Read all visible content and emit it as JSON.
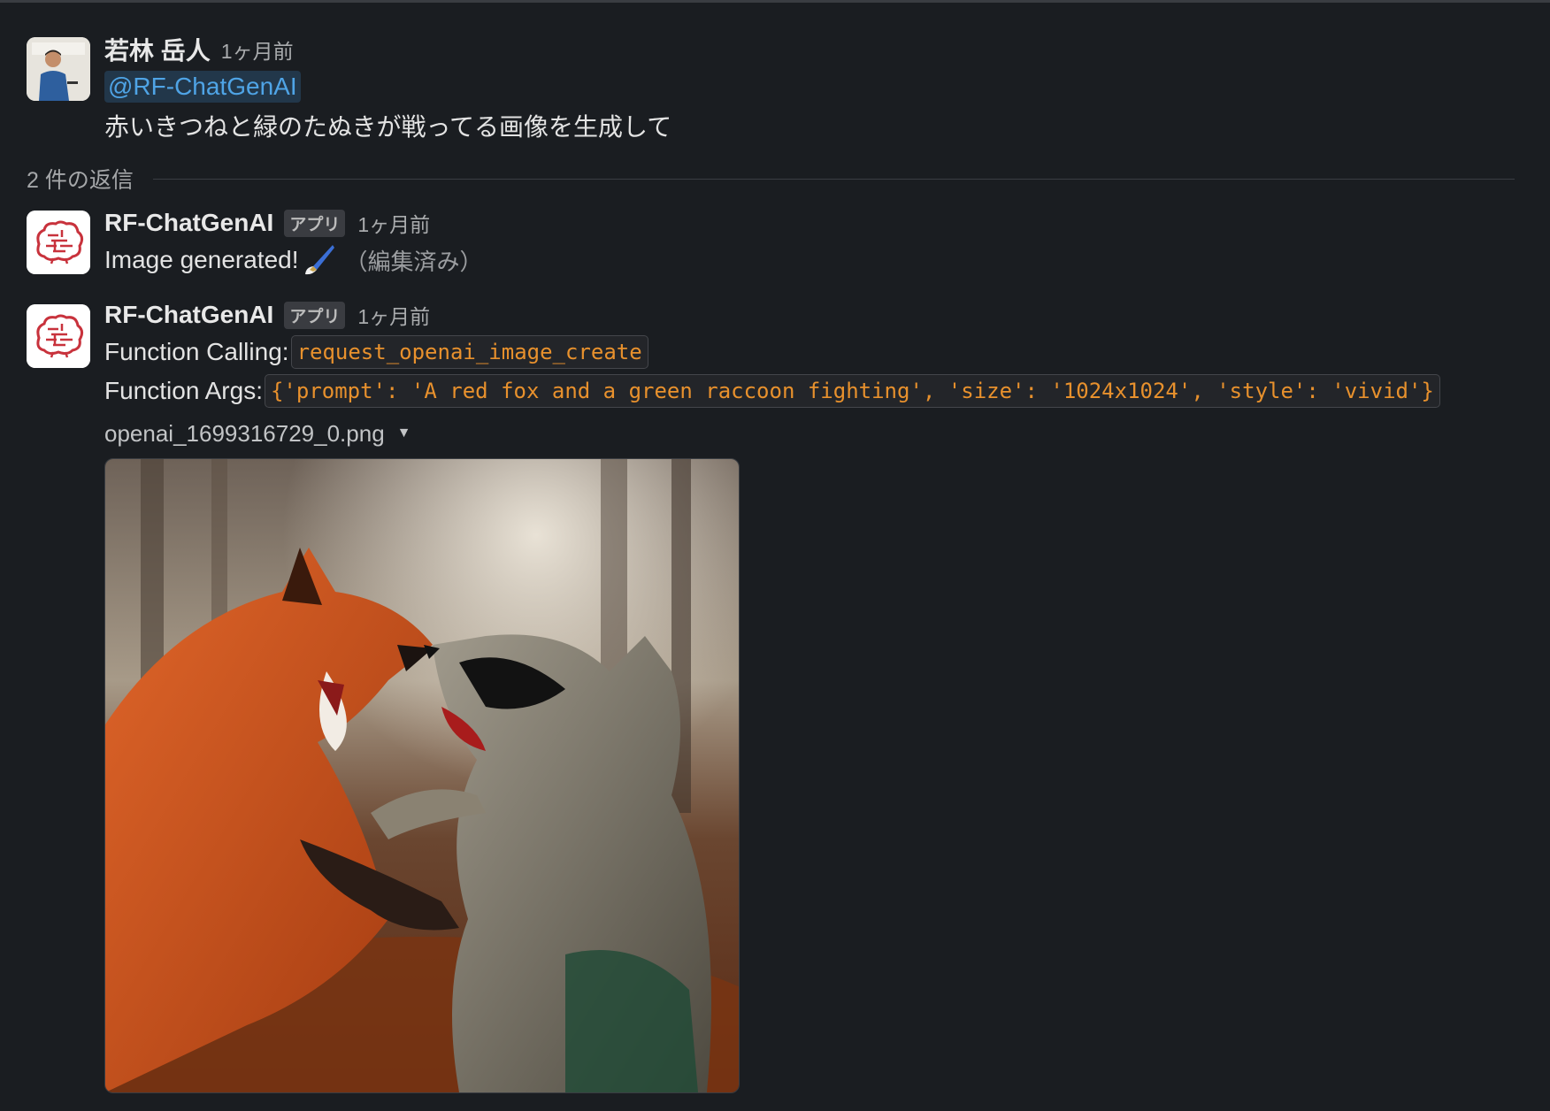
{
  "original_message": {
    "author": "若林 岳人",
    "time": "1ヶ月前",
    "mention": "@RF-ChatGenAI",
    "text": "赤いきつねと緑のたぬきが戦ってる画像を生成して"
  },
  "thread": {
    "replies_label": "2 件の返信"
  },
  "replies": [
    {
      "author": "RF-ChatGenAI",
      "badge": "アプリ",
      "time": "1ヶ月前",
      "text": "Image generated!",
      "emoji": "paintbrush-icon",
      "edited": "（編集済み）"
    },
    {
      "author": "RF-ChatGenAI",
      "badge": "アプリ",
      "time": "1ヶ月前",
      "function_calling_label": "Function Calling:",
      "function_name": "request_openai_image_create",
      "function_args_label": "Function Args:",
      "function_args": "{'prompt': 'A red fox and a green raccoon fighting', 'size': '1024x1024', 'style': 'vivid'}",
      "file_name": "openai_1699316729_0.png"
    }
  ],
  "colors": {
    "background": "#1a1d21",
    "mention": "#4fa4e6",
    "code_text": "#e8912d"
  }
}
